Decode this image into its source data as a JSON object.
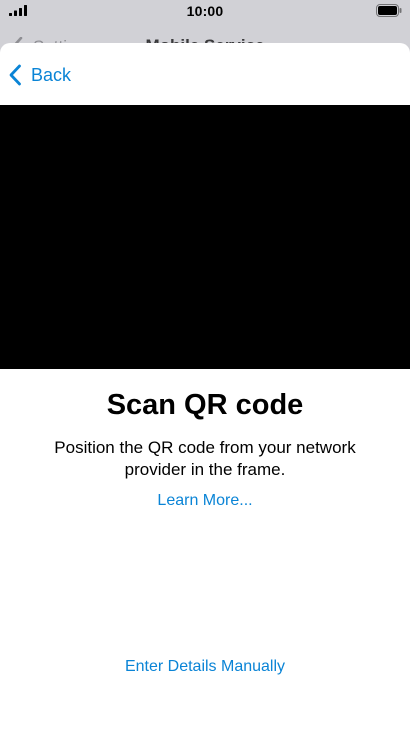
{
  "status_bar": {
    "time": "10:00",
    "signal_icon": "cellular-signal-icon",
    "battery_icon": "battery-full-icon"
  },
  "background_nav": {
    "back_label": "Settings",
    "title": "Mobile Service"
  },
  "nav": {
    "back_label": "Back"
  },
  "content": {
    "title": "Scan QR code",
    "description": "Position the QR code from your network provider in the frame.",
    "learn_more": "Learn More...",
    "manual_entry": "Enter Details Manually"
  },
  "colors": {
    "accent": "#0a84d6",
    "camera_background": "#000000",
    "sheet_background": "#ffffff",
    "dimmed_background": "#d1d1d6"
  }
}
